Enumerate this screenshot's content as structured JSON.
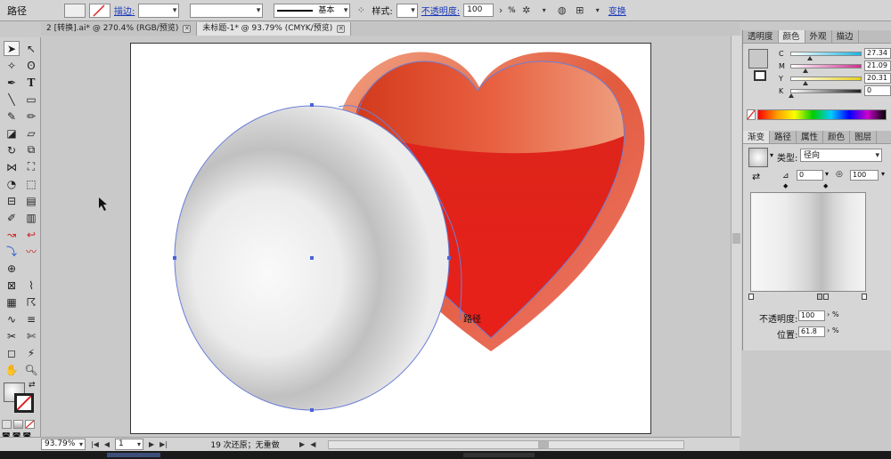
{
  "control_bar": {
    "object_type": "路径",
    "stroke_label": "描边:",
    "stroke_profile": "基本",
    "style_label": "样式:",
    "opacity_label": "不透明度:",
    "opacity_value": "100",
    "opacity_unit": "%",
    "isolate_label": "变换"
  },
  "tabs": [
    {
      "label": "2 [转换].ai* @ 270.4% (RGB/预览)"
    },
    {
      "label": "未标题-1* @ 93.79% (CMYK/预览)"
    }
  ],
  "canvas": {
    "hover_label": "路径"
  },
  "status_bar": {
    "zoom": "93.79%",
    "page": "1",
    "history": "19 次还原；无重做"
  },
  "color_panel": {
    "tabs": [
      "透明度",
      "颜色",
      "外观",
      "描边"
    ],
    "channels": [
      {
        "name": "C",
        "value": "27.34",
        "fraction": 0.27,
        "color": "#18b6e6"
      },
      {
        "name": "M",
        "value": "21.09",
        "fraction": 0.21,
        "color": "#d12f8f"
      },
      {
        "name": "Y",
        "value": "20.31",
        "fraction": 0.2,
        "color": "#e6d11e"
      },
      {
        "name": "K",
        "value": "0",
        "fraction": 0.0,
        "color": "#222222"
      }
    ],
    "unit": "%"
  },
  "gradient_panel": {
    "tabs": [
      "渐变",
      "路径",
      "属性",
      "颜色",
      "图层"
    ],
    "type_label": "类型:",
    "type_value": "径向",
    "angle_value": "0",
    "aspect_value": "100",
    "opacity_label": "不透明度:",
    "opacity_value": "100",
    "location_label": "位置:",
    "location_value": "61.8",
    "unit": "%"
  }
}
